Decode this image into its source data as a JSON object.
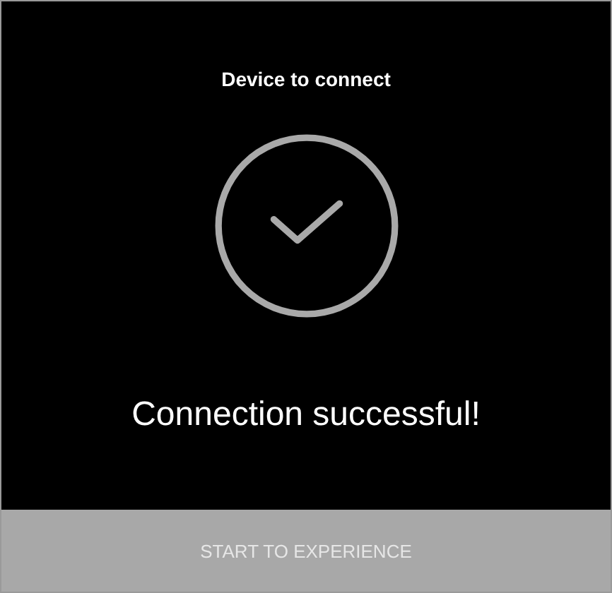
{
  "title": "Device to connect",
  "status": {
    "kind": "success",
    "message": "Connection successful!"
  },
  "action_button": {
    "label": "START TO EXPERIENCE",
    "disabled": true
  }
}
